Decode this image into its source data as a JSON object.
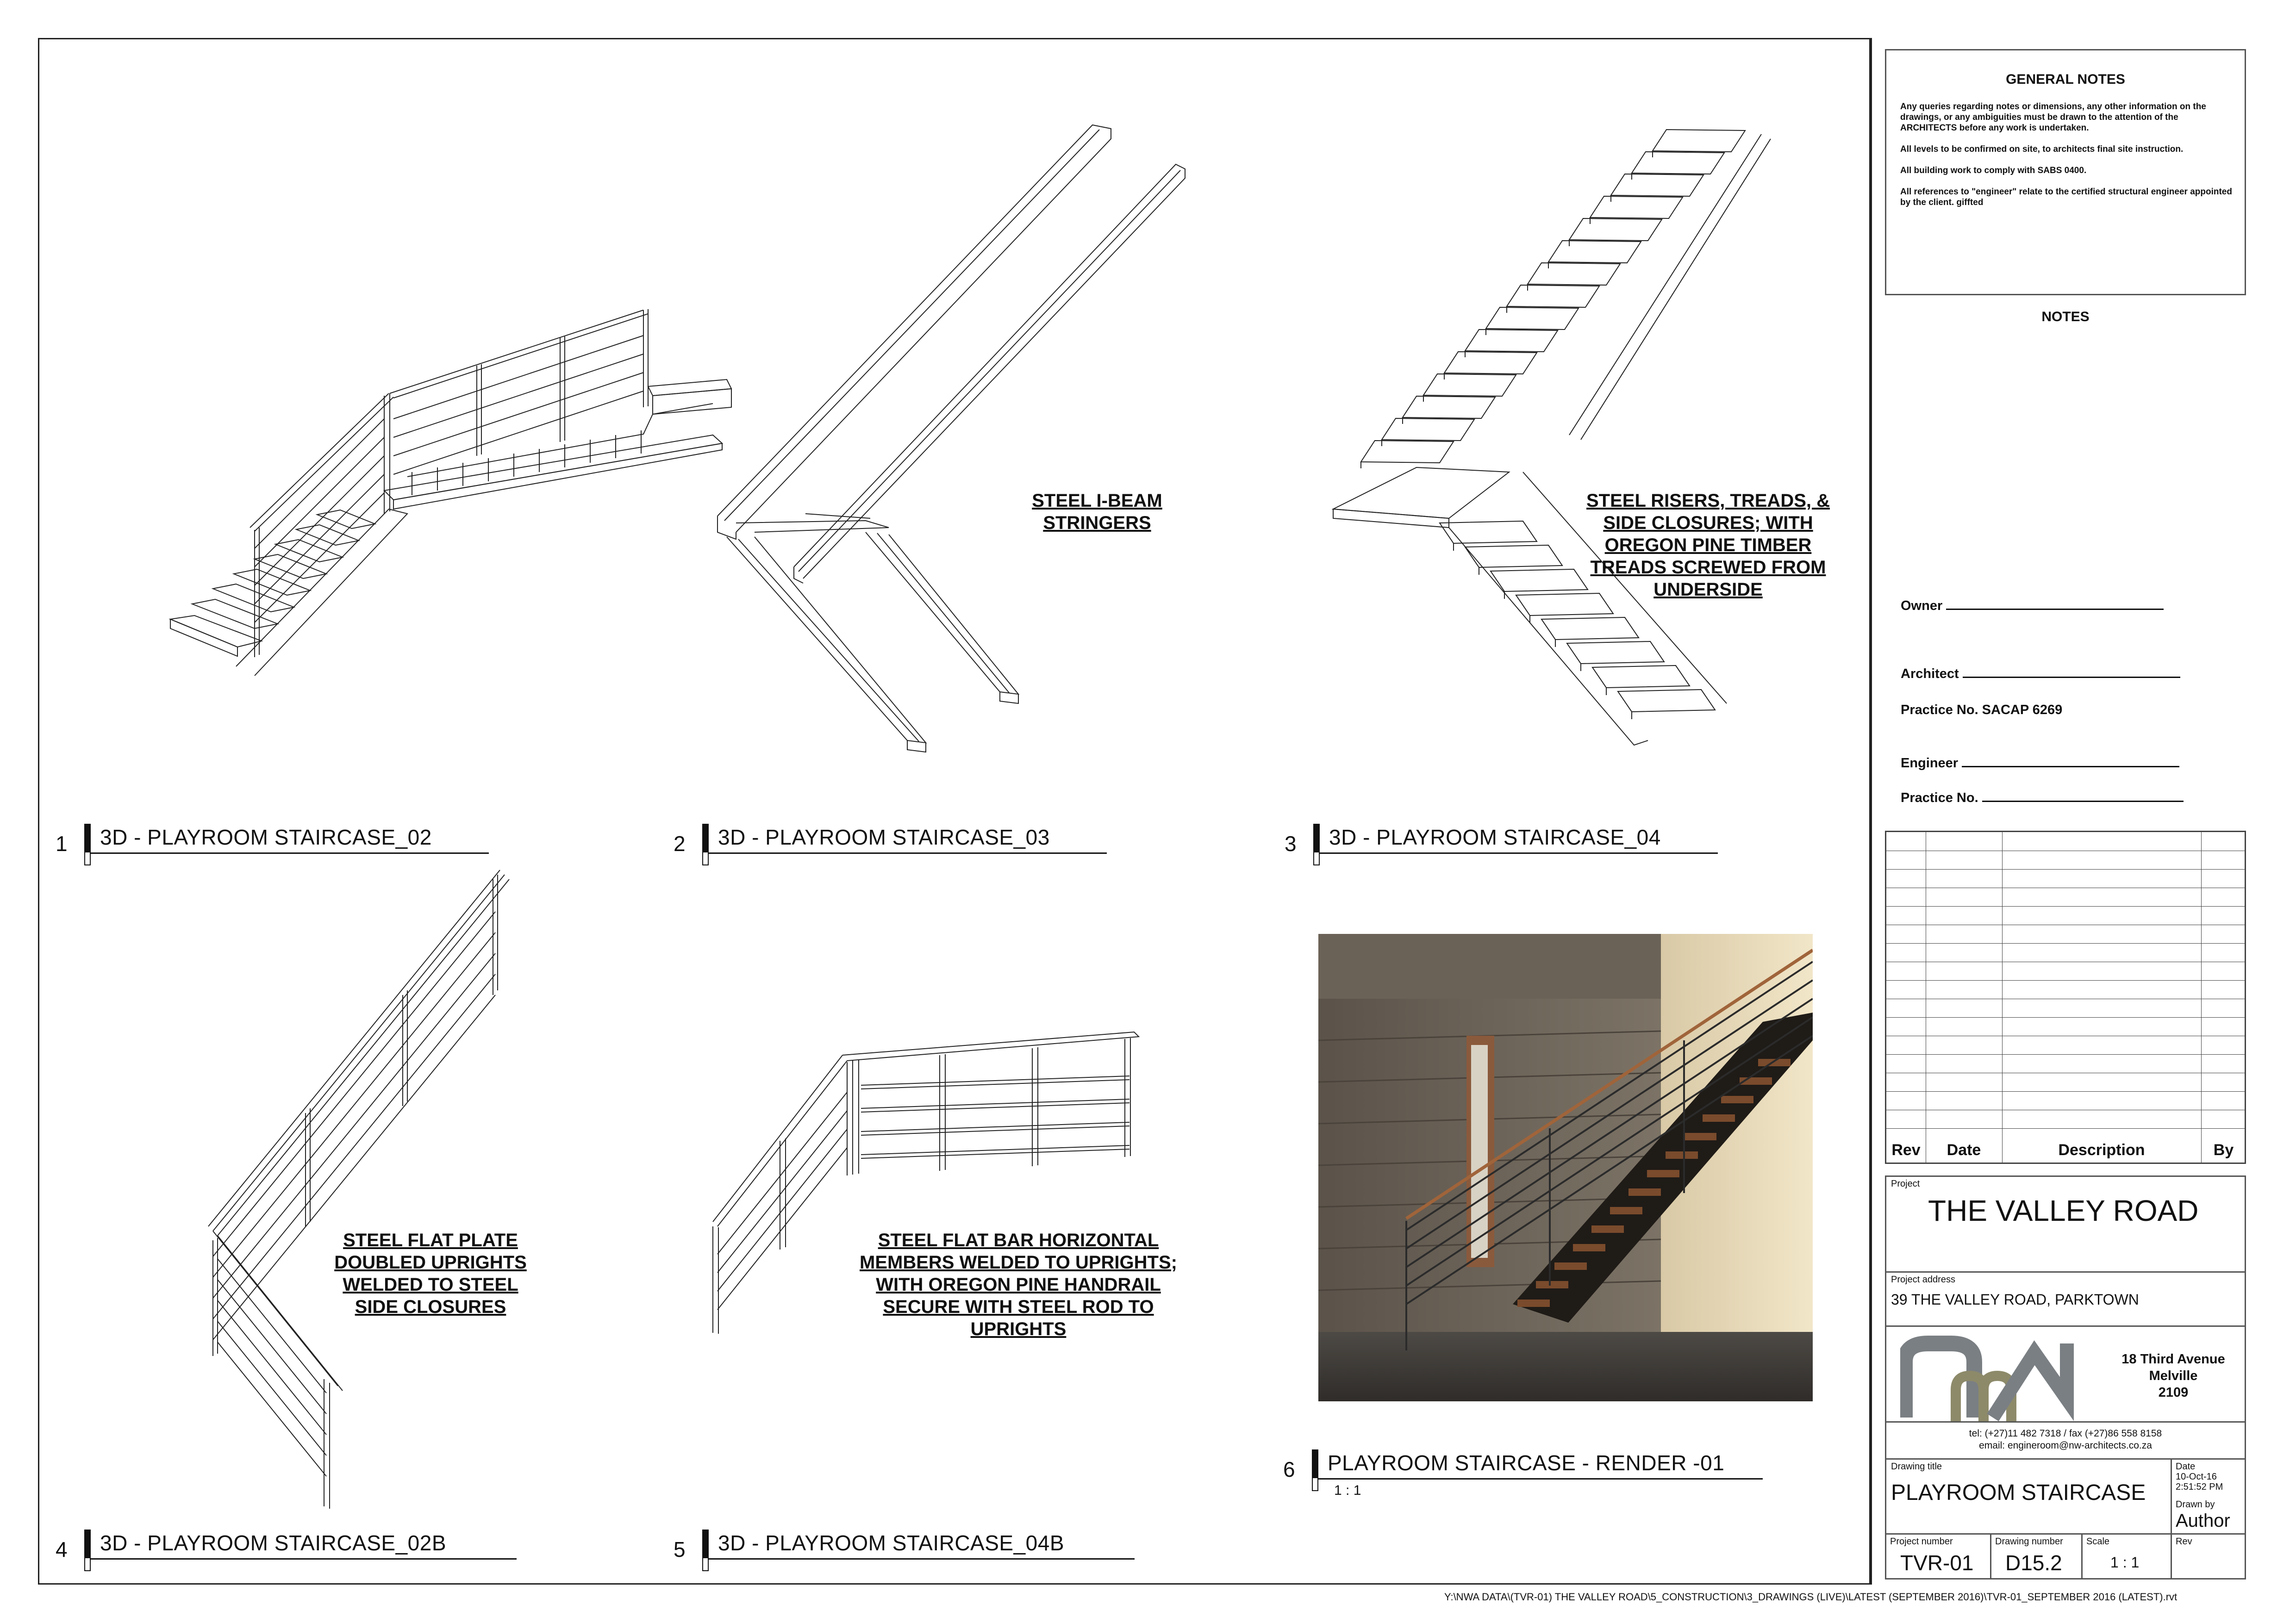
{
  "views": [
    {
      "number": "1",
      "title": "3D - PLAYROOM STAIRCASE_02"
    },
    {
      "number": "2",
      "title": "3D - PLAYROOM STAIRCASE_03"
    },
    {
      "number": "3",
      "title": "3D - PLAYROOM STAIRCASE_04"
    },
    {
      "number": "4",
      "title": "3D - PLAYROOM STAIRCASE_02B"
    },
    {
      "number": "5",
      "title": "3D - PLAYROOM STAIRCASE_04B"
    },
    {
      "number": "6",
      "title": "PLAYROOM STAIRCASE - RENDER -01",
      "scale": "1 : 1"
    }
  ],
  "annotations": {
    "stringers": "STEEL I-BEAM\nSTRINGERS",
    "risers": "STEEL RISERS, TREADS, &\nSIDE CLOSURES; WITH\nOREGON PINE TIMBER\nTREADS SCREWED FROM\nUNDERSIDE",
    "uprights": "STEEL FLAT PLATE\nDOUBLED UPRIGHTS\nWELDED TO STEEL\nSIDE CLOSURES",
    "flat_bar": "STEEL FLAT BAR HORIZONTAL\nMEMBERS WELDED TO UPRIGHTS;\nWITH OREGON PINE HANDRAIL\nSECURE WITH STEEL ROD TO\nUPRIGHTS"
  },
  "general_notes": {
    "title": "GENERAL NOTES",
    "paragraphs": [
      "Any queries regarding notes or dimensions, any other information on the drawings, or any ambiguities must be drawn to the attention of the ARCHITECTS before any work is undertaken.",
      "All levels to be confirmed on site, to architects final site instruction.",
      "All building work to comply with SABS 0400.",
      "All references to \"engineer\" relate to the certified structural engineer appointed by the client. giffted"
    ]
  },
  "notes_title": "NOTES",
  "signoff": {
    "owner": "Owner",
    "architect": "Architect",
    "practice_sacap": "Practice No. SACAP 6269",
    "engineer": "Engineer",
    "practice": "Practice No."
  },
  "revisions": {
    "rev": "Rev",
    "date": "Date",
    "description": "Description",
    "by": "By"
  },
  "project": {
    "label": "Project",
    "name": "THE VALLEY ROAD",
    "address_label": "Project address",
    "address": "39 THE VALLEY ROAD, PARKTOWN"
  },
  "firm": {
    "address_line1": "18 Third Avenue",
    "address_line2": "Melville",
    "address_line3": "2109",
    "tel": "tel: (+27)11 482 7318 / fax (+27)86 558 8158",
    "email": "email: engineroom@nw-architects.co.za"
  },
  "drawing": {
    "title_label": "Drawing title",
    "title": "PLAYROOM STAIRCASE",
    "date_label": "Date",
    "date": "10-Oct-16",
    "time": "2:51:52 PM",
    "drawn_by_label": "Drawn by",
    "drawn_by": "Author",
    "project_number_label": "Project number",
    "project_number": "TVR-01",
    "drawing_number_label": "Drawing number",
    "drawing_number": "D15.2",
    "scale_label": "Scale",
    "scale": "1 : 1",
    "rev_label": "Rev"
  },
  "file_path": "Y:\\NWA DATA\\(TVR-01) THE VALLEY ROAD\\5_CONSTRUCTION\\3_DRAWINGS (LIVE)\\LATEST (SEPTEMBER 2016)\\TVR-01_SEPTEMBER 2016 (LATEST).rvt",
  "colors": {
    "logo_grey": "#7a7f83",
    "logo_olive": "#8d8a6a",
    "line": "#222222"
  }
}
